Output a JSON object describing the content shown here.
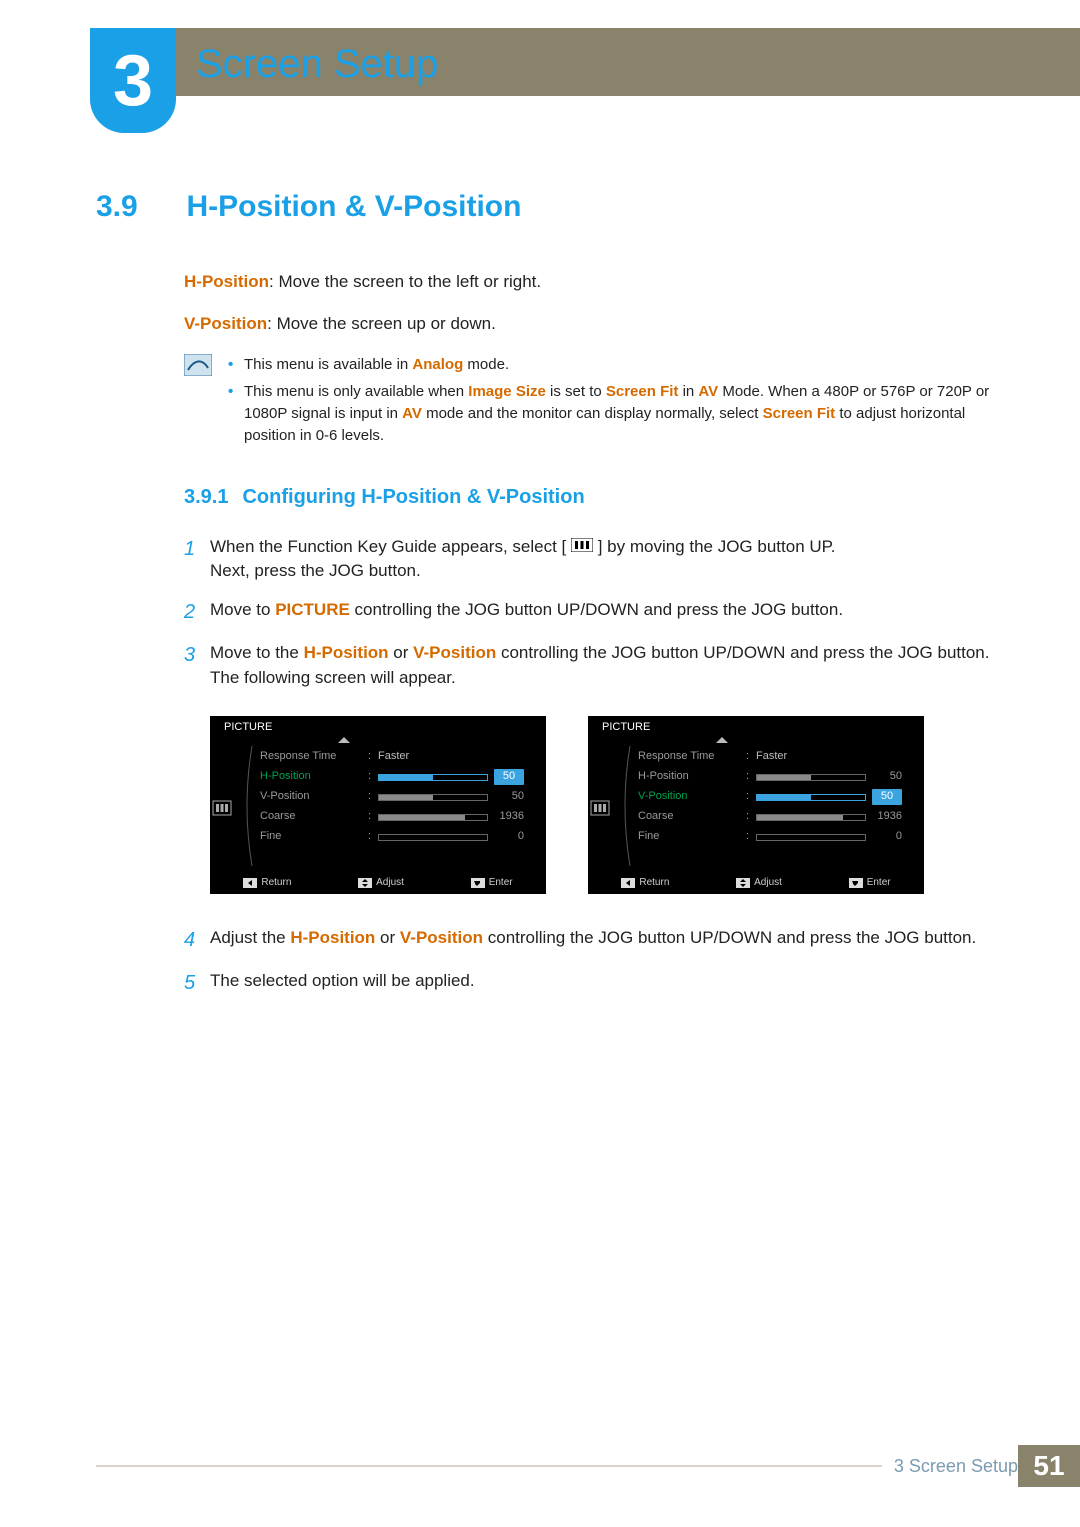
{
  "chapter": {
    "number": "3",
    "title": "Screen Setup"
  },
  "section": {
    "number": "3.9",
    "title": "H-Position & V-Position",
    "hpos_label": "H-Position",
    "hpos_text": ": Move the screen to the left or right.",
    "vpos_label": "V-Position",
    "vpos_text": ": Move the screen up or down.",
    "notes": [
      {
        "pre": "This menu is available in ",
        "term": "Analog",
        "post": " mode."
      },
      {
        "full_html": "This menu is only available when <span class=\"term\">Image Size</span> is set to <span class=\"term\">Screen Fit</span> in <span class=\"term\">AV</span> Mode. When a 480P or 576P or 720P or 1080P signal is input in <span class=\"term\">AV</span> mode and the monitor can display normally, select <span class=\"term\">Screen Fit</span> to adjust horizontal position in 0-6 levels."
      }
    ]
  },
  "subsection": {
    "number": "3.9.1",
    "title": "Configuring H-Position & V-Position"
  },
  "steps": [
    {
      "n": "1",
      "html": "When the Function Key Guide appears, select [ <span class=\"inline-icon\" data-name=\"menu-icon\"><svg width=\"22\" height=\"14\" viewBox=\"0 0 22 14\"><rect x=\"0\" y=\"0\" width=\"22\" height=\"14\" fill=\"none\" stroke=\"#000\"/><rect x=\"4\" y=\"3\" width=\"3\" height=\"8\" fill=\"#000\"/><rect x=\"9.5\" y=\"3\" width=\"3\" height=\"8\" fill=\"#000\"/><rect x=\"15\" y=\"3\" width=\"3\" height=\"8\" fill=\"#000\"/></svg></span> ] by moving the JOG button UP.<br>Next, press the JOG button."
    },
    {
      "n": "2",
      "html": "Move to <span class=\"term\">PICTURE</span> controlling the JOG button UP/DOWN and press the JOG button."
    },
    {
      "n": "3",
      "html": "Move to the <span class=\"term\">H-Position</span> or  <span class=\"term\">V-Position</span> controlling the JOG button UP/DOWN and press the JOG button. The following screen will appear."
    },
    {
      "n": "4",
      "html": "Adjust the <span class=\"term\">H-Position</span> or <span class=\"term\">V-Position</span> controlling the JOG button UP/DOWN and press the JOG button."
    },
    {
      "n": "5",
      "html": "The selected option will be applied."
    }
  ],
  "osd": {
    "title": "PICTURE",
    "footer": {
      "return": "Return",
      "adjust": "Adjust",
      "enter": "Enter"
    },
    "items": [
      {
        "label": "Response Time",
        "type": "text",
        "value": "Faster"
      },
      {
        "label": "H-Position",
        "type": "slider",
        "value": "50",
        "fill": 50
      },
      {
        "label": "V-Position",
        "type": "slider",
        "value": "50",
        "fill": 50
      },
      {
        "label": "Coarse",
        "type": "slider",
        "value": "1936",
        "fill": 80
      },
      {
        "label": "Fine",
        "type": "slider",
        "value": "0",
        "fill": 0
      }
    ],
    "left_active_index": 1,
    "right_active_index": 2
  },
  "footer": {
    "chapter_ref": "3 Screen Setup",
    "page": "51"
  }
}
